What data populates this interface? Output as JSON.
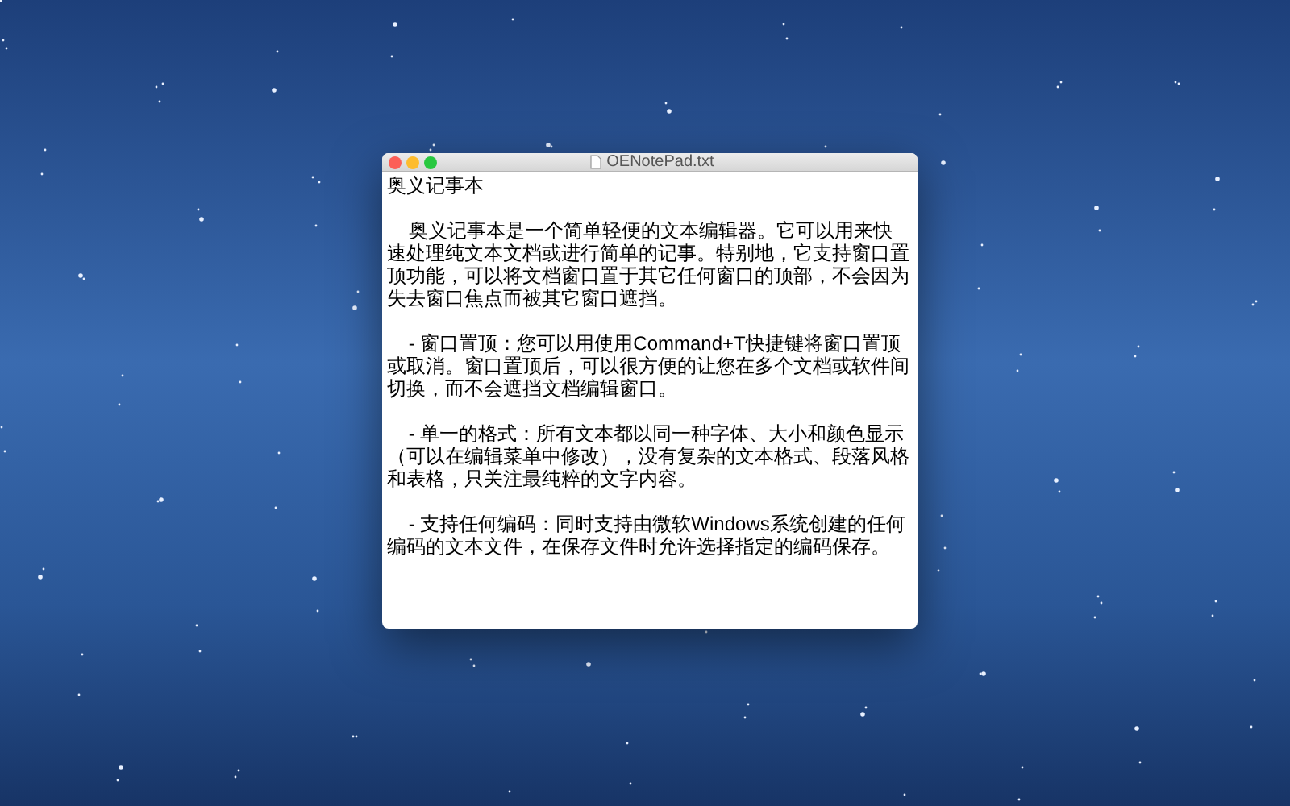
{
  "window": {
    "title": "OENotePad.txt"
  },
  "document": {
    "heading": "奥义记事本",
    "paragraphs": [
      "    奥义记事本是一个简单轻便的文本编辑器。它可以用来快速处理纯文本文档或进行简单的记事。特别地，它支持窗口置顶功能，可以将文档窗口置于其它任何窗口的顶部，不会因为失去窗口焦点而被其它窗口遮挡。",
      "    - 窗口置顶：您可以用使用Command+T快捷键将窗口置顶或取消。窗口置顶后，可以很方便的让您在多个文档或软件间切换，而不会遮挡文档编辑窗口。",
      "    - 单一的格式：所有文本都以同一种字体、大小和颜色显示（可以在编辑菜单中修改），没有复杂的文本格式、段落风格和表格，只关注最纯粹的文字内容。",
      "    - 支持任何编码：同时支持由微软Windows系统创建的任何编码的文本文件，在保存文件时允许选择指定的编码保存。"
    ]
  }
}
